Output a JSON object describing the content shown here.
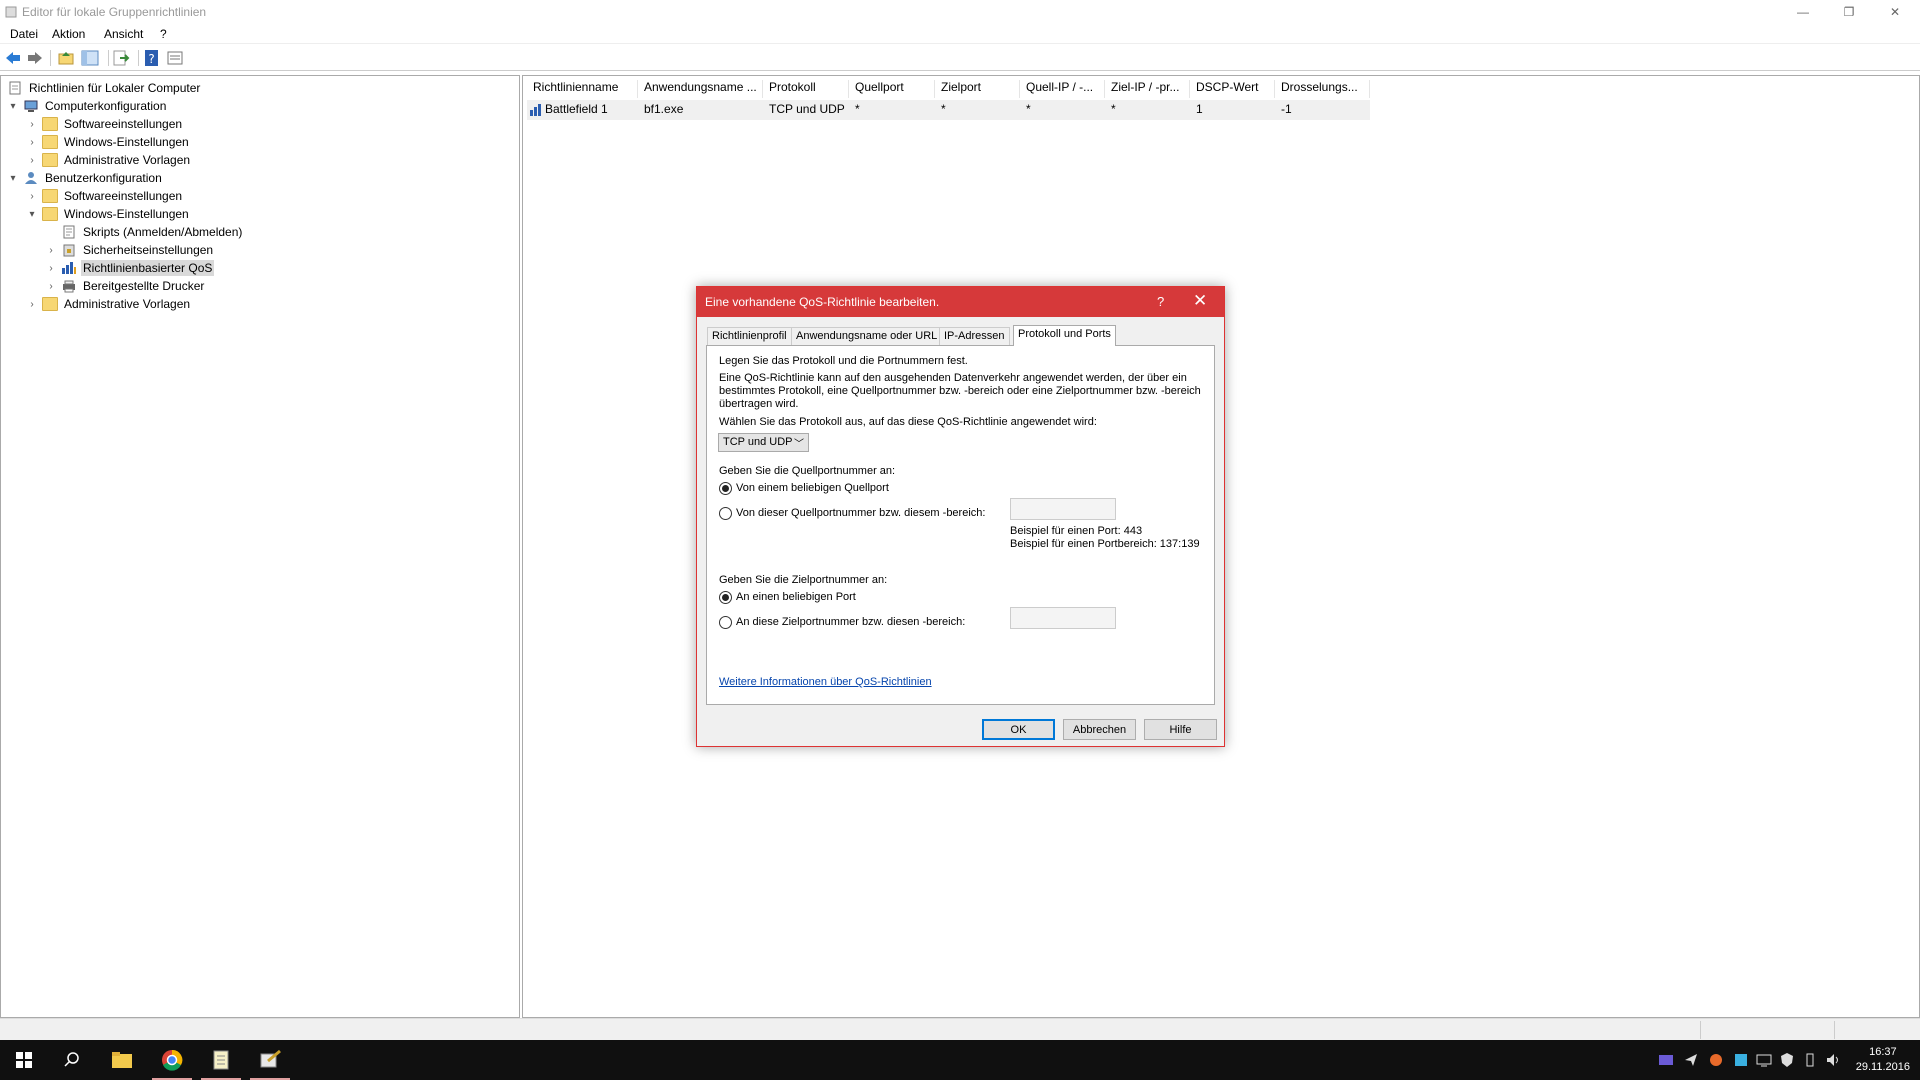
{
  "window": {
    "title": "Editor für lokale Gruppenrichtlinien",
    "min": "—",
    "max": "❐",
    "close": "✕"
  },
  "menu": [
    "Datei",
    "Aktion",
    "Ansicht",
    "?"
  ],
  "tree": [
    {
      "label": "Richtlinien für Lokaler Computer",
      "icon": "policy-doc-icon",
      "expander": ""
    },
    {
      "label": "Computerkonfiguration",
      "icon": "computer-icon",
      "expander": "▾"
    },
    {
      "label": "Softwareeinstellungen",
      "icon": "folder-icon",
      "expander": "›"
    },
    {
      "label": "Windows-Einstellungen",
      "icon": "folder-icon",
      "expander": "›"
    },
    {
      "label": "Administrative Vorlagen",
      "icon": "folder-icon",
      "expander": "›"
    },
    {
      "label": "Benutzerkonfiguration",
      "icon": "user-icon",
      "expander": "▾"
    },
    {
      "label": "Softwareeinstellungen",
      "icon": "folder-icon",
      "expander": "›"
    },
    {
      "label": "Windows-Einstellungen",
      "icon": "folder-icon",
      "expander": "▾"
    },
    {
      "label": "Skripts (Anmelden/Abmelden)",
      "icon": "script-icon",
      "expander": ""
    },
    {
      "label": "Sicherheitseinstellungen",
      "icon": "security-icon",
      "expander": "›"
    },
    {
      "label": "Richtlinienbasierter QoS",
      "icon": "qos-chart-icon",
      "expander": "›",
      "selected": true
    },
    {
      "label": "Bereitgestellte Drucker",
      "icon": "printer-icon",
      "expander": "›"
    },
    {
      "label": "Administrative Vorlagen",
      "icon": "folder-icon",
      "expander": "›"
    }
  ],
  "list": {
    "columns": [
      "Richtlinienname",
      "Anwendungsname ...",
      "Protokoll",
      "Quellport",
      "Zielport",
      "Quell-IP / -...",
      "Ziel-IP / -pr...",
      "DSCP-Wert",
      "Drosselungs..."
    ],
    "rows": [
      [
        "Battlefield 1",
        "bf1.exe",
        "TCP und UDP",
        "*",
        "*",
        "*",
        "*",
        "1",
        "-1"
      ]
    ]
  },
  "dialog": {
    "title": "Eine vorhandene QoS-Richtlinie bearbeiten.",
    "help_glyph": "?",
    "close_glyph": "✕",
    "tabs": [
      "Richtlinienprofil",
      "Anwendungsname oder URL",
      "IP-Adressen",
      "Protokoll und Ports"
    ],
    "active_tab": "Protokoll und Ports",
    "heading": "Legen Sie das Protokoll und die Portnummern fest.",
    "description": "Eine QoS-Richtlinie kann auf den ausgehenden Datenverkehr angewendet werden, der über ein bestimmtes Protokoll, eine Quellportnummer bzw. -bereich oder eine Zielportnummer bzw. -bereich übertragen wird.",
    "protocol_label": "Wählen Sie das Protokoll aus, auf das diese QoS-Richtlinie angewendet wird:",
    "protocol_value": "TCP und UDP",
    "source_label": "Geben Sie die Quellportnummer an:",
    "source_any": "Von einem beliebigen Quellport",
    "source_specific": "Von dieser Quellportnummer bzw. diesem -bereich:",
    "example_port": "Beispiel für einen Port: 443",
    "example_range": "Beispiel für einen Portbereich: 137:139",
    "dest_label": "Geben Sie die Zielportnummer an:",
    "dest_any": "An einen beliebigen Port",
    "dest_specific": "An diese Zielportnummer bzw. diesen -bereich:",
    "link": "Weitere Informationen über QoS-Richtlinien",
    "buttons": {
      "ok": "OK",
      "cancel": "Abbrechen",
      "help": "Hilfe"
    }
  },
  "taskbar": {
    "time": "16:37",
    "date": "29.11.2016"
  },
  "colors": {
    "dialog_title": "#d6393a",
    "link": "#0645ad",
    "taskbar": "#101010"
  }
}
